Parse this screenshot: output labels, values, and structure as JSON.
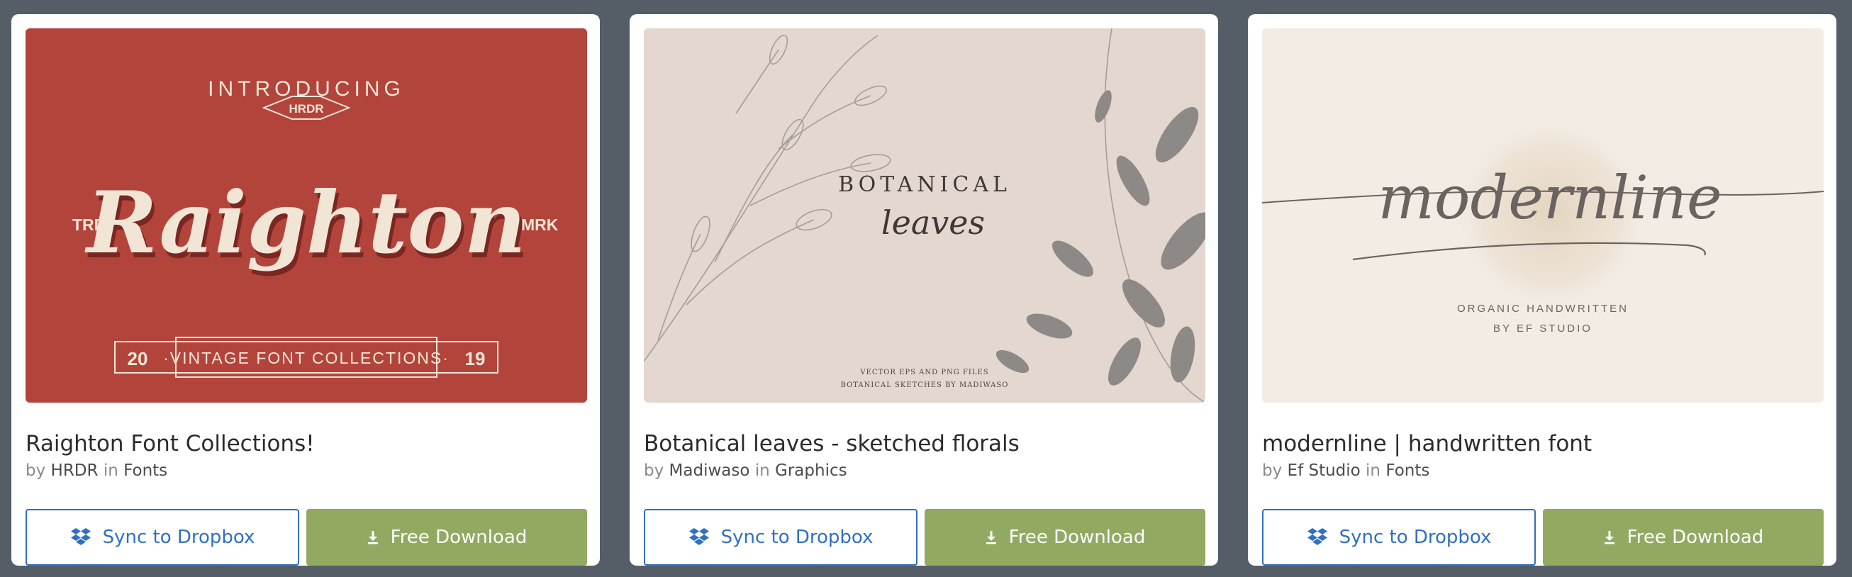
{
  "cards": [
    {
      "title": "Raighton Font Collections!",
      "by_label": "by",
      "author": "HRDR",
      "in_label": "in",
      "category": "Fonts",
      "thumb": {
        "bg": "#b3443c",
        "cream": "#f1e6d6",
        "intro": "INTRODUCING",
        "badge": "HRDR",
        "word": "Raighton",
        "left_tag": "TRD",
        "right_tag": "MRK",
        "year_left": "20",
        "year_right": "19",
        "subtitle": "·VINTAGE FONT COLLECTIONS·"
      },
      "sync_label": "Sync to Dropbox",
      "download_label": "Free Download"
    },
    {
      "title": "Botanical leaves - sketched florals",
      "by_label": "by",
      "author": "Madiwaso",
      "in_label": "in",
      "category": "Graphics",
      "thumb": {
        "bg": "#e4d7d0",
        "heading": "BOTANICAL",
        "script": "leaves",
        "caption1": "VECTOR EPS AND PNG FILES",
        "caption2": "BOTANICAL SKETCHES BY MADIWASO"
      },
      "sync_label": "Sync to Dropbox",
      "download_label": "Free Download"
    },
    {
      "title": "modernline | handwritten font",
      "by_label": "by",
      "author": "Ef Studio",
      "in_label": "in",
      "category": "Fonts",
      "thumb": {
        "bg": "#f2ece4",
        "word": "modernline",
        "line1": "ORGANIC HANDWRITTEN",
        "line2": "BY EF STUDIO"
      },
      "sync_label": "Sync to Dropbox",
      "download_label": "Free Download"
    }
  ],
  "colors": {
    "page_bg": "#555d66",
    "dropbox_blue": "#2f70c1",
    "download_green": "#92a962"
  },
  "icons": {
    "sync": "dropbox-icon",
    "download": "download-arrow-icon"
  }
}
